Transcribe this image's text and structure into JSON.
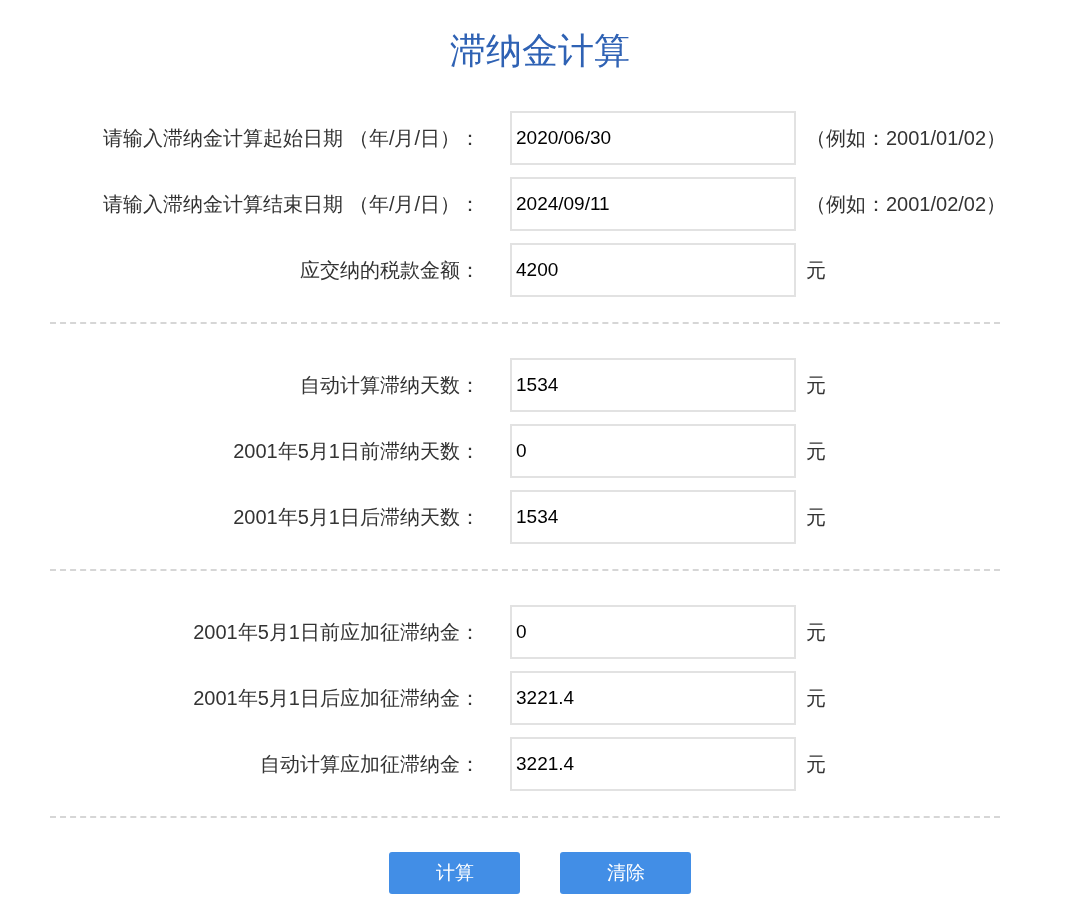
{
  "title": "滞纳金计算",
  "sections": [
    {
      "rows": [
        {
          "label": "请输入滞纳金计算起始日期 （年/月/日）：",
          "value": "2020/06/30",
          "suffix": "（例如：2001/01/02）"
        },
        {
          "label": "请输入滞纳金计算结束日期 （年/月/日）：",
          "value": "2024/09/11",
          "suffix": "（例如：2001/02/02）"
        },
        {
          "label": "应交纳的税款金额：",
          "value": "4200",
          "suffix": "元"
        }
      ]
    },
    {
      "rows": [
        {
          "label": "自动计算滞纳天数：",
          "value": "1534",
          "suffix": "元"
        },
        {
          "label": "2001年5月1日前滞纳天数：",
          "value": "0",
          "suffix": "元"
        },
        {
          "label": "2001年5月1日后滞纳天数：",
          "value": "1534",
          "suffix": "元"
        }
      ]
    },
    {
      "rows": [
        {
          "label": "2001年5月1日前应加征滞纳金：",
          "value": "0",
          "suffix": "元"
        },
        {
          "label": "2001年5月1日后应加征滞纳金：",
          "value": "3221.4",
          "suffix": "元"
        },
        {
          "label": "自动计算应加征滞纳金：",
          "value": "3221.4",
          "suffix": "元"
        }
      ]
    }
  ],
  "buttons": [
    "计算",
    "清除"
  ]
}
